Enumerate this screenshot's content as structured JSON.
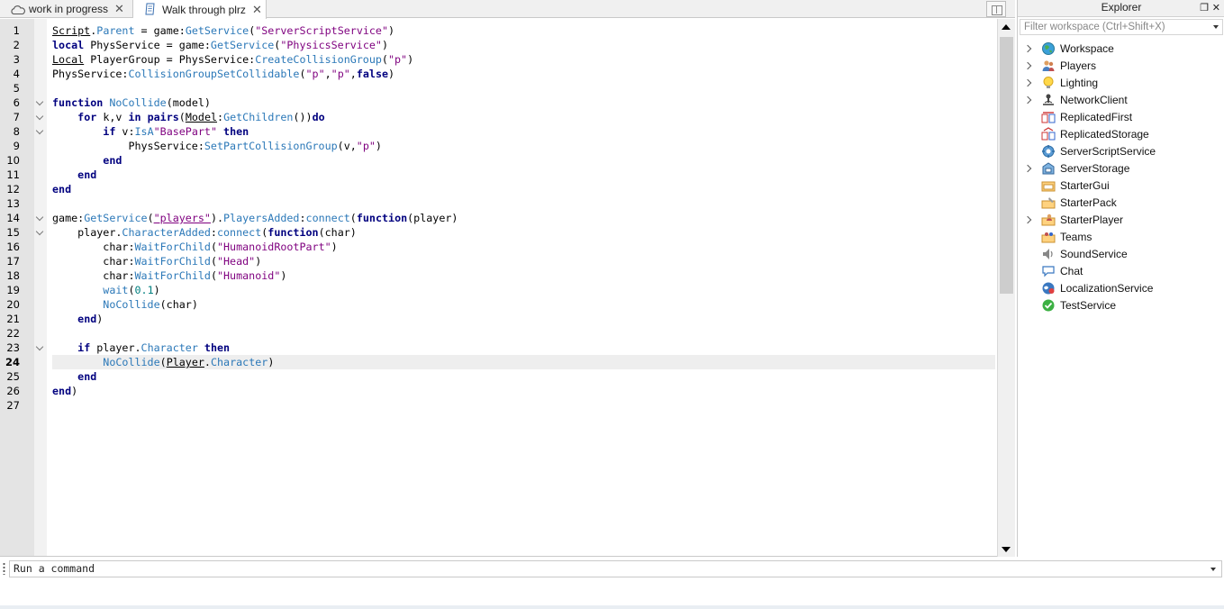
{
  "tabs": [
    {
      "label": "work in progress",
      "icon": "cloud-icon",
      "close": "✕"
    },
    {
      "label": "Walk through plrz",
      "icon": "script-icon",
      "close": "✕",
      "active": true
    }
  ],
  "editor": {
    "current_line": 24,
    "lines": [
      {
        "n": "1",
        "tokens": [
          [
            "Script",
            "und"
          ],
          [
            ".",
            "plain"
          ],
          [
            "Parent",
            "fn"
          ],
          [
            " = game:",
            "plain"
          ],
          [
            "GetService",
            "fn"
          ],
          [
            "(",
            "plain"
          ],
          [
            "\"ServerScriptService\"",
            "str"
          ],
          [
            ")",
            "plain"
          ]
        ]
      },
      {
        "n": "2",
        "tokens": [
          [
            "local",
            "kw"
          ],
          [
            " PhysService = game:",
            "plain"
          ],
          [
            "GetService",
            "fn"
          ],
          [
            "(",
            "plain"
          ],
          [
            "\"PhysicsService\"",
            "str"
          ],
          [
            ")",
            "plain"
          ]
        ]
      },
      {
        "n": "3",
        "tokens": [
          [
            "Local",
            "und"
          ],
          [
            " PlayerGroup = PhysService:",
            "plain"
          ],
          [
            "CreateCollisionGroup",
            "fn"
          ],
          [
            "(",
            "plain"
          ],
          [
            "\"p\"",
            "str"
          ],
          [
            ")",
            "plain"
          ]
        ]
      },
      {
        "n": "4",
        "tokens": [
          [
            "PhysService:",
            "plain"
          ],
          [
            "CollisionGroupSetCollidable",
            "fn"
          ],
          [
            "(",
            "plain"
          ],
          [
            "\"p\"",
            "str"
          ],
          [
            ",",
            "plain"
          ],
          [
            "\"p\"",
            "str"
          ],
          [
            ",",
            "plain"
          ],
          [
            "false",
            "kw"
          ],
          [
            ")",
            "plain"
          ]
        ]
      },
      {
        "n": "5",
        "tokens": []
      },
      {
        "n": "6",
        "fold": true,
        "tokens": [
          [
            "function",
            "kw"
          ],
          [
            " ",
            "plain"
          ],
          [
            "NoCollide",
            "fn"
          ],
          [
            "(model)",
            "plain"
          ]
        ]
      },
      {
        "n": "7",
        "fold": true,
        "tokens": [
          [
            "    ",
            "plain"
          ],
          [
            "for",
            "kw"
          ],
          [
            " k,v ",
            "plain"
          ],
          [
            "in",
            "kw"
          ],
          [
            " ",
            "plain"
          ],
          [
            "pairs",
            "kw"
          ],
          [
            "(",
            "plain"
          ],
          [
            "Model",
            "und"
          ],
          [
            ":",
            "plain"
          ],
          [
            "GetChildren",
            "fn"
          ],
          [
            "())",
            "plain"
          ],
          [
            "do",
            "kw"
          ]
        ]
      },
      {
        "n": "8",
        "fold": true,
        "tokens": [
          [
            "        ",
            "plain"
          ],
          [
            "if",
            "kw"
          ],
          [
            " v:",
            "plain"
          ],
          [
            "IsA",
            "fn"
          ],
          [
            "\"BasePart\"",
            "str"
          ],
          [
            " ",
            "plain"
          ],
          [
            "then",
            "kw"
          ]
        ]
      },
      {
        "n": "9",
        "tokens": [
          [
            "            PhysService:",
            "plain"
          ],
          [
            "SetPartCollisionGroup",
            "fn"
          ],
          [
            "(v,",
            "plain"
          ],
          [
            "\"p\"",
            "str"
          ],
          [
            ")",
            "plain"
          ]
        ]
      },
      {
        "n": "10",
        "tokens": [
          [
            "        ",
            "plain"
          ],
          [
            "end",
            "kw"
          ]
        ]
      },
      {
        "n": "11",
        "tokens": [
          [
            "    ",
            "plain"
          ],
          [
            "end",
            "kw"
          ]
        ]
      },
      {
        "n": "12",
        "tokens": [
          [
            "end",
            "kw"
          ]
        ]
      },
      {
        "n": "13",
        "tokens": []
      },
      {
        "n": "14",
        "fold": true,
        "tokens": [
          [
            "game:",
            "plain"
          ],
          [
            "GetService",
            "fn"
          ],
          [
            "(",
            "plain"
          ],
          [
            "\"players\"",
            "str und"
          ],
          [
            ").",
            "plain"
          ],
          [
            "PlayersAdded",
            "fn"
          ],
          [
            ":",
            "plain"
          ],
          [
            "connect",
            "fn"
          ],
          [
            "(",
            "plain"
          ],
          [
            "function",
            "kw"
          ],
          [
            "(player)",
            "plain"
          ]
        ]
      },
      {
        "n": "15",
        "fold": true,
        "tokens": [
          [
            "    player.",
            "plain"
          ],
          [
            "CharacterAdded",
            "fn"
          ],
          [
            ":",
            "plain"
          ],
          [
            "connect",
            "fn"
          ],
          [
            "(",
            "plain"
          ],
          [
            "function",
            "kw"
          ],
          [
            "(char)",
            "plain"
          ]
        ]
      },
      {
        "n": "16",
        "tokens": [
          [
            "        char:",
            "plain"
          ],
          [
            "WaitForChild",
            "fn"
          ],
          [
            "(",
            "plain"
          ],
          [
            "\"HumanoidRootPart\"",
            "str"
          ],
          [
            ")",
            "plain"
          ]
        ]
      },
      {
        "n": "17",
        "tokens": [
          [
            "        char:",
            "plain"
          ],
          [
            "WaitForChild",
            "fn"
          ],
          [
            "(",
            "plain"
          ],
          [
            "\"Head\"",
            "str"
          ],
          [
            ")",
            "plain"
          ]
        ]
      },
      {
        "n": "18",
        "tokens": [
          [
            "        char:",
            "plain"
          ],
          [
            "WaitForChild",
            "fn"
          ],
          [
            "(",
            "plain"
          ],
          [
            "\"Humanoid\"",
            "str"
          ],
          [
            ")",
            "plain"
          ]
        ]
      },
      {
        "n": "19",
        "tokens": [
          [
            "        ",
            "plain"
          ],
          [
            "wait",
            "fn"
          ],
          [
            "(",
            "plain"
          ],
          [
            "0.1",
            "num"
          ],
          [
            ")",
            "plain"
          ]
        ]
      },
      {
        "n": "20",
        "tokens": [
          [
            "        ",
            "plain"
          ],
          [
            "NoCollide",
            "fn"
          ],
          [
            "(char)",
            "plain"
          ]
        ]
      },
      {
        "n": "21",
        "tokens": [
          [
            "    ",
            "plain"
          ],
          [
            "end",
            "kw"
          ],
          [
            ")",
            "plain"
          ]
        ]
      },
      {
        "n": "22",
        "tokens": []
      },
      {
        "n": "23",
        "fold": true,
        "tokens": [
          [
            "    ",
            "plain"
          ],
          [
            "if",
            "kw"
          ],
          [
            " player.",
            "plain"
          ],
          [
            "Character",
            "fn"
          ],
          [
            " ",
            "plain"
          ],
          [
            "then",
            "kw"
          ]
        ]
      },
      {
        "n": "24",
        "tokens": [
          [
            "        ",
            "plain"
          ],
          [
            "NoCollide",
            "fn"
          ],
          [
            "(",
            "plain"
          ],
          [
            "Player",
            "und"
          ],
          [
            ".",
            "plain"
          ],
          [
            "Character",
            "fn"
          ],
          [
            ")",
            "plain"
          ]
        ]
      },
      {
        "n": "25",
        "tokens": [
          [
            "    ",
            "plain"
          ],
          [
            "end",
            "kw"
          ]
        ]
      },
      {
        "n": "26",
        "tokens": [
          [
            "end",
            "kw"
          ],
          [
            ")",
            "plain"
          ]
        ]
      },
      {
        "n": "27",
        "tokens": []
      }
    ]
  },
  "explorer": {
    "title": "Explorer",
    "filter_placeholder": "Filter workspace (Ctrl+Shift+X)",
    "items": [
      {
        "label": "Workspace",
        "icon": "globe-icon",
        "expandable": true
      },
      {
        "label": "Players",
        "icon": "players-icon",
        "expandable": true
      },
      {
        "label": "Lighting",
        "icon": "lightbulb-icon",
        "expandable": true
      },
      {
        "label": "NetworkClient",
        "icon": "network-icon",
        "expandable": true
      },
      {
        "label": "ReplicatedFirst",
        "icon": "replicated-first-icon",
        "expandable": false
      },
      {
        "label": "ReplicatedStorage",
        "icon": "replicated-storage-icon",
        "expandable": false
      },
      {
        "label": "ServerScriptService",
        "icon": "server-script-service-icon",
        "expandable": false
      },
      {
        "label": "ServerStorage",
        "icon": "server-storage-icon",
        "expandable": true
      },
      {
        "label": "StarterGui",
        "icon": "starter-gui-icon",
        "expandable": false
      },
      {
        "label": "StarterPack",
        "icon": "starter-pack-icon",
        "expandable": false
      },
      {
        "label": "StarterPlayer",
        "icon": "starter-player-icon",
        "expandable": true
      },
      {
        "label": "Teams",
        "icon": "teams-icon",
        "expandable": false
      },
      {
        "label": "SoundService",
        "icon": "speaker-icon",
        "expandable": false
      },
      {
        "label": "Chat",
        "icon": "chat-bubble-icon",
        "expandable": false
      },
      {
        "label": "LocalizationService",
        "icon": "localization-icon",
        "expandable": false
      },
      {
        "label": "TestService",
        "icon": "checkmark-icon",
        "expandable": false
      }
    ]
  },
  "command": {
    "placeholder": "Run a command"
  },
  "colors": {
    "keyword": "#00007f",
    "function": "#2b78b8",
    "string": "#7f007f",
    "number": "#007f7f"
  }
}
